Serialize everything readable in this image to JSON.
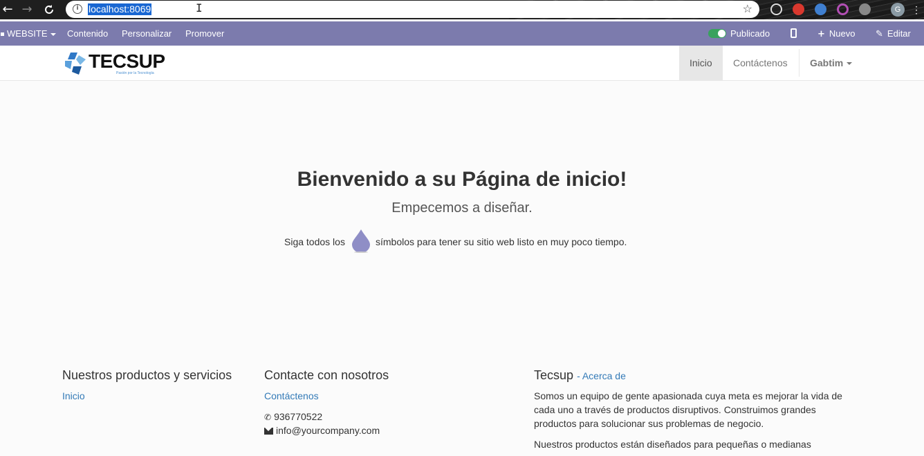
{
  "browser": {
    "back_icon": "←",
    "forward_icon": "→",
    "reload_icon": "C",
    "url": "localhost:8069",
    "star_icon": "☆",
    "profile_initial": "G",
    "menu_icon": "⋮"
  },
  "admin_bar": {
    "website_label": "WEBSITE",
    "content_label": "Contenido",
    "customize_label": "Personalizar",
    "promote_label": "Promover",
    "published_label": "Publicado",
    "new_label": "Nuevo",
    "edit_label": "Editar",
    "background_color": "#7c7bad",
    "published_toggle_color": "#38a25d"
  },
  "header": {
    "logo_text": "TECSUP",
    "logo_tagline": "Pasión por la Tecnología",
    "nav": [
      {
        "label": "Inicio",
        "active": true
      },
      {
        "label": "Contáctenos",
        "active": false
      }
    ],
    "user_menu": "Gabtim"
  },
  "hero": {
    "title_pre": "Bienvenido a su ",
    "title_bold": "Página de inicio",
    "title_post": "!",
    "subtitle": "Empecemos a diseñar.",
    "hint_pre": "Siga todos los",
    "hint_post": "símbolos para tener su sitio web listo en muy poco tiempo.",
    "drop_color": "#8f8ec6"
  },
  "footer": {
    "products": {
      "heading": "Nuestros productos y servicios",
      "links": [
        "Inicio"
      ]
    },
    "contact": {
      "heading": "Contacte con nosotros",
      "link": "Contáctenos",
      "phone": "936770522",
      "email": "info@yourcompany.com"
    },
    "about": {
      "heading": "Tecsup",
      "link": "- Acerca de",
      "p1_lines": [
        "Somos un equipo de gente apasionada cuya meta es mejorar la vida de",
        "cada uno a través de productos disruptivos. Construimos grandes",
        "productos para solucionar sus problemas de negocio."
      ],
      "p2_line": "Nuestros productos están diseñados para pequeñas o medianas"
    }
  }
}
